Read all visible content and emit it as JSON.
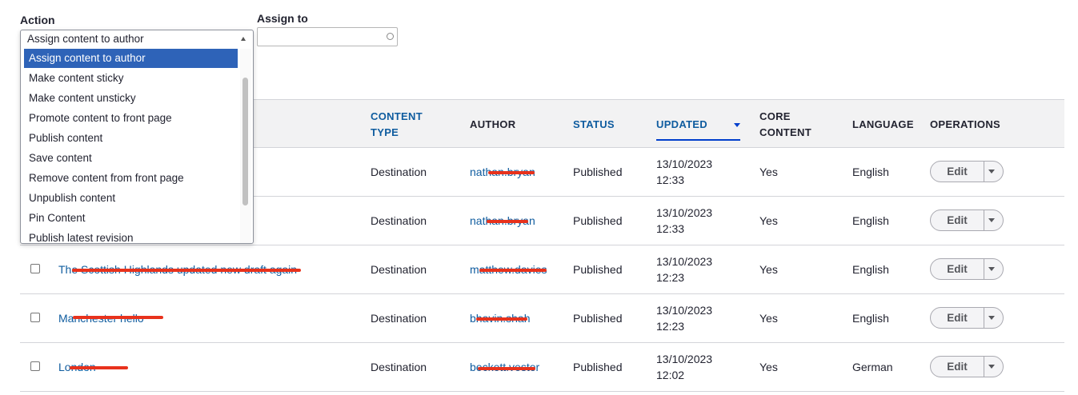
{
  "form": {
    "action_label": "Action",
    "assign_label": "Assign to",
    "action_selected": "Assign content to author",
    "assign_value": ""
  },
  "dropdown": {
    "options": [
      "Assign content to author",
      "Make content sticky",
      "Make content unsticky",
      "Promote content to front page",
      "Publish content",
      "Save content",
      "Remove content from front page",
      "Unpublish content",
      "Pin Content",
      "Publish latest revision"
    ],
    "selected_index": 0
  },
  "table": {
    "headers": {
      "content_type": "CONTENT TYPE",
      "author": "AUTHOR",
      "status": "STATUS",
      "updated": "UPDATED",
      "core_content": "CORE CONTENT",
      "language": "LANGUAGE",
      "operations": "OPERATIONS"
    },
    "rows": [
      {
        "title": "",
        "type": "Destination",
        "author": "nathan.bryan",
        "status": "Published",
        "date": "13/10/2023",
        "time": "12:33",
        "core": "Yes",
        "language": "English",
        "op": "Edit"
      },
      {
        "title": "",
        "type": "Destination",
        "author": "nathan.bryan",
        "status": "Published",
        "date": "13/10/2023",
        "time": "12:33",
        "core": "Yes",
        "language": "English",
        "op": "Edit"
      },
      {
        "title": "The Scottish Highlands updated new draft again",
        "type": "Destination",
        "author": "matthew.davies",
        "status": "Published",
        "date": "13/10/2023",
        "time": "12:23",
        "core": "Yes",
        "language": "English",
        "op": "Edit"
      },
      {
        "title": "Manchester hello",
        "type": "Destination",
        "author": "bhavin.shah",
        "status": "Published",
        "date": "13/10/2023",
        "time": "12:23",
        "core": "Yes",
        "language": "English",
        "op": "Edit"
      },
      {
        "title": "London",
        "type": "Destination",
        "author": "beckett.vester",
        "status": "Published",
        "date": "13/10/2023",
        "time": "12:02",
        "core": "Yes",
        "language": "German",
        "op": "Edit"
      }
    ]
  },
  "colors": {
    "link": "#0f5c9f",
    "selected_option": "#2e63b8",
    "redaction": "#e8321c",
    "sort_indicator": "#003ecc"
  }
}
